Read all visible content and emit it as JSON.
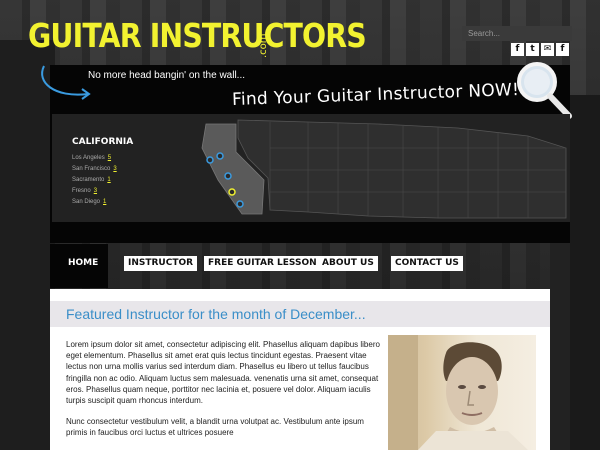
{
  "brand": {
    "logo_text": "GUITAR INSTRUCTORS",
    "logo_suffix": ".com",
    "accent_color": "#f2f230"
  },
  "search": {
    "placeholder": "Search..."
  },
  "social": [
    "f",
    "t",
    "✉",
    "f"
  ],
  "hero": {
    "tagline": "No more head bangin' on the wall...",
    "cta": "Find Your Guitar Instructor NOW!",
    "state": "CALIFORNIA",
    "cities": [
      {
        "name": "Los Angeles",
        "count": "5"
      },
      {
        "name": "San Francisco",
        "count": "3"
      },
      {
        "name": "Sacramento",
        "count": "1"
      },
      {
        "name": "Fresno",
        "count": "3"
      },
      {
        "name": "San Diego",
        "count": "1"
      }
    ]
  },
  "nav": [
    "HOME",
    "INSTRUCTOR",
    "FREE GUITAR LESSON",
    "ABOUT US",
    "CONTACT US"
  ],
  "content": {
    "featured_title": "Featured Instructor for the month of December...",
    "paragraph1": "Lorem ipsum dolor sit amet, consectetur adipiscing elit. Phasellus aliquam dapibus libero eget elementum. Phasellus sit amet erat quis lectus tincidunt egestas. Praesent vitae lectus non urna mollis varius sed interdum diam. Phasellus eu libero ut tellus faucibus fringilla non ac odio. Aliquam luctus sem malesuada. venenatis urna sit amet, consequat eros. Phasellus quam neque, porttitor nec lacinia et, posuere vel dolor. Aliquam iaculis turpis suscipit quam rhoncus interdum.",
    "paragraph2": "Nunc consectetur vestibulum velit, a blandit urna volutpat ac. Vestibulum ante ipsum primis in faucibus orci luctus et ultrices posuere"
  }
}
